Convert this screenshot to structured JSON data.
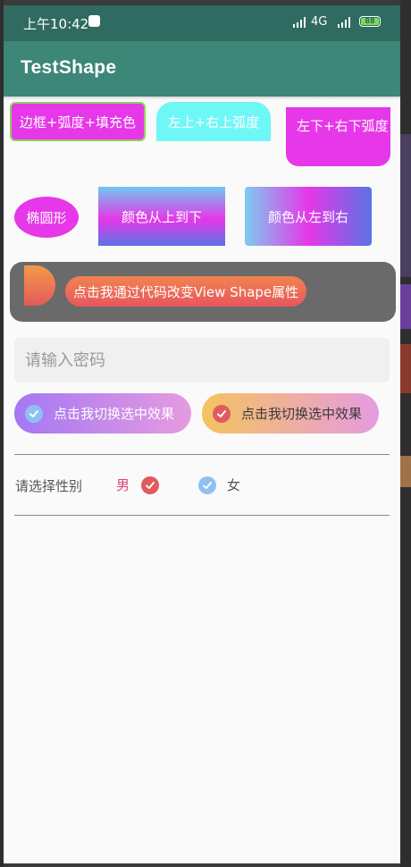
{
  "status_bar": {
    "time": "上午10:42",
    "network": "4G",
    "battery": "88"
  },
  "app_bar": {
    "title": "TestShape"
  },
  "shapes": {
    "border_radius_fill": "边框+弧度+填充色",
    "top_corners": "左上+右上弧度",
    "bottom_corners": "左下+右下弧度",
    "oval": "椭圆形",
    "gradient_vertical": "颜色从上到下",
    "gradient_horizontal": "颜色从左到右"
  },
  "code_panel": {
    "button_label": "点击我通过代码改变View Shape属性"
  },
  "password": {
    "placeholder": "请输入密码",
    "value": ""
  },
  "toggles": [
    {
      "label": "点击我切换选中效果"
    },
    {
      "label": "点击我切换选中效果"
    }
  ],
  "gender": {
    "label": "请选择性别",
    "male": "男",
    "female": "女"
  },
  "colors": {
    "status_bar": "#2f6b60",
    "app_bar": "#3c8777",
    "magenta": "#e637e8",
    "cyan": "#6ff7f7",
    "checked_red": "#e05a5f",
    "checked_blue": "#8ec1f2"
  },
  "icons": [
    "notification-icon",
    "signal-icon",
    "battery-icon",
    "check-icon"
  ]
}
